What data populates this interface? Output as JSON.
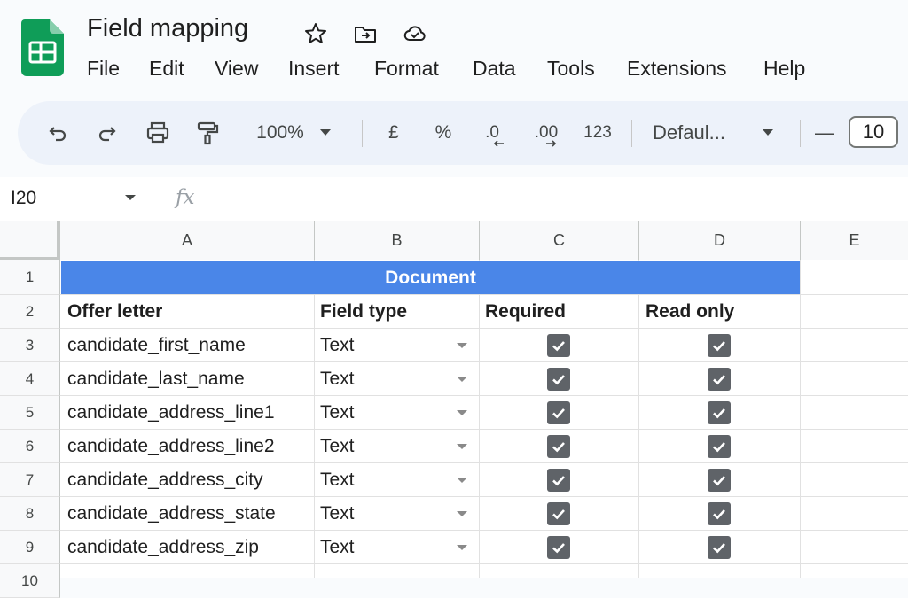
{
  "app": {
    "title": "Field mapping",
    "brand_color": "#0f9d58"
  },
  "menu": [
    "File",
    "Edit",
    "View",
    "Insert",
    "Format",
    "Data",
    "Tools",
    "Extensions",
    "Help"
  ],
  "toolbar": {
    "zoom": "100%",
    "currency": "£",
    "percent": "%",
    "decrease_decimal": ".0",
    "increase_decimal": ".00",
    "number_format": "123",
    "font": "Defaul...",
    "font_size": "10",
    "decrease_font_size": "—"
  },
  "formula_bar": {
    "cell_ref": "I20",
    "fx": "fx",
    "value": ""
  },
  "sheet": {
    "columns": [
      "A",
      "B",
      "C",
      "D",
      "E"
    ],
    "rows": [
      "1",
      "2",
      "3",
      "4",
      "5",
      "6",
      "7",
      "8",
      "9",
      "10"
    ],
    "banner": "Document",
    "banner_color": "#4a86e8",
    "headers": [
      "Offer letter",
      "Field type",
      "Required",
      "Read only"
    ],
    "data": [
      {
        "field": "candidate_first_name",
        "type": "Text",
        "required": true,
        "read_only": true
      },
      {
        "field": "candidate_last_name",
        "type": "Text",
        "required": true,
        "read_only": true
      },
      {
        "field": "candidate_address_line1",
        "type": "Text",
        "required": true,
        "read_only": true
      },
      {
        "field": "candidate_address_line2",
        "type": "Text",
        "required": true,
        "read_only": true
      },
      {
        "field": "candidate_address_city",
        "type": "Text",
        "required": true,
        "read_only": true
      },
      {
        "field": "candidate_address_state",
        "type": "Text",
        "required": true,
        "read_only": true
      },
      {
        "field": "candidate_address_zip",
        "type": "Text",
        "required": true,
        "read_only": true
      }
    ]
  }
}
